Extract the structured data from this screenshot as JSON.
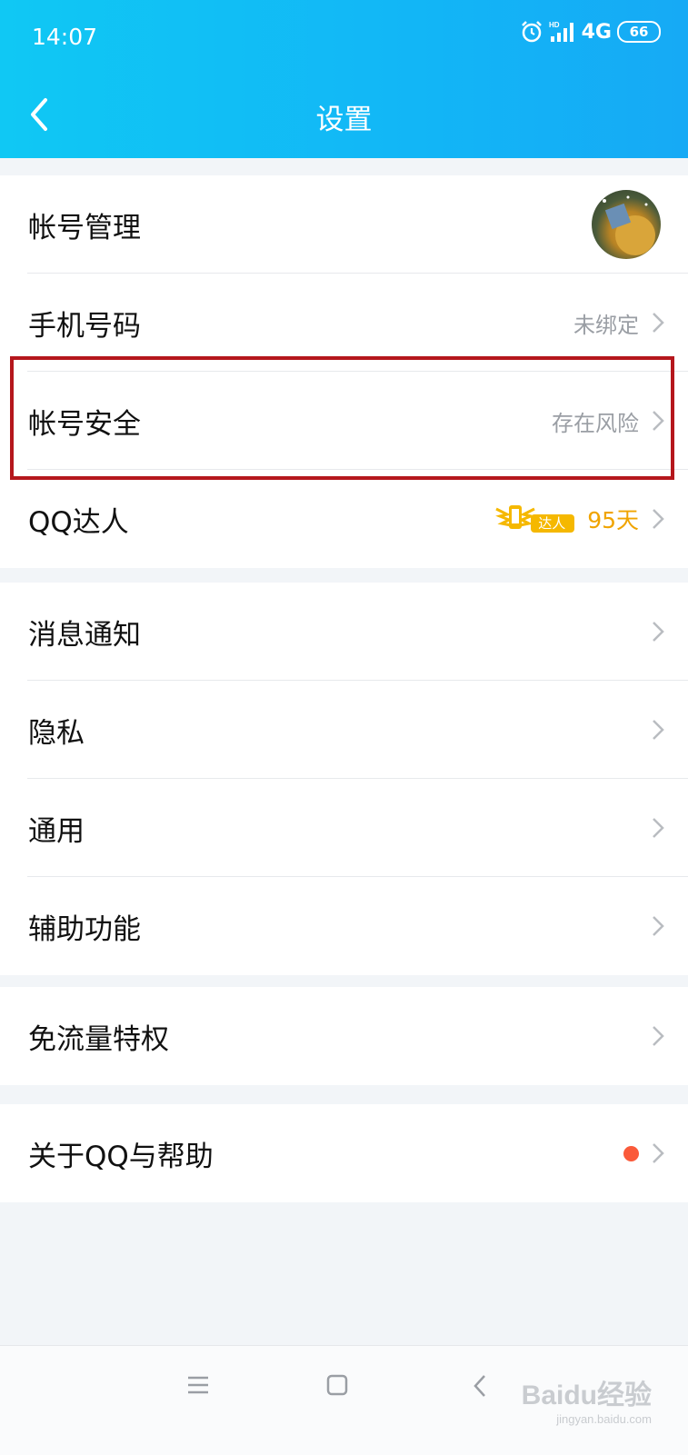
{
  "status": {
    "time": "14:07",
    "network": "4G",
    "battery": "66"
  },
  "header": {
    "title": "设置"
  },
  "groups": [
    {
      "items": [
        {
          "label": "帐号管理"
        },
        {
          "label": "手机号码",
          "value": "未绑定"
        },
        {
          "label": "帐号安全",
          "value": "存在风险"
        },
        {
          "label": "QQ达人",
          "badge_text": "达人",
          "days": "95天"
        }
      ]
    },
    {
      "items": [
        {
          "label": "消息通知"
        },
        {
          "label": "隐私"
        },
        {
          "label": "通用"
        },
        {
          "label": "辅助功能"
        }
      ]
    },
    {
      "items": [
        {
          "label": "免流量特权"
        }
      ]
    },
    {
      "items": [
        {
          "label": "关于QQ与帮助"
        }
      ]
    }
  ],
  "colors": {
    "accent": "#12b6f6",
    "highlight_border": "#b5171c",
    "badge": "#f0a400",
    "dot": "#fa5a3a"
  },
  "watermark": {
    "brand": "Baidu经验",
    "url": "jingyan.baidu.com"
  }
}
